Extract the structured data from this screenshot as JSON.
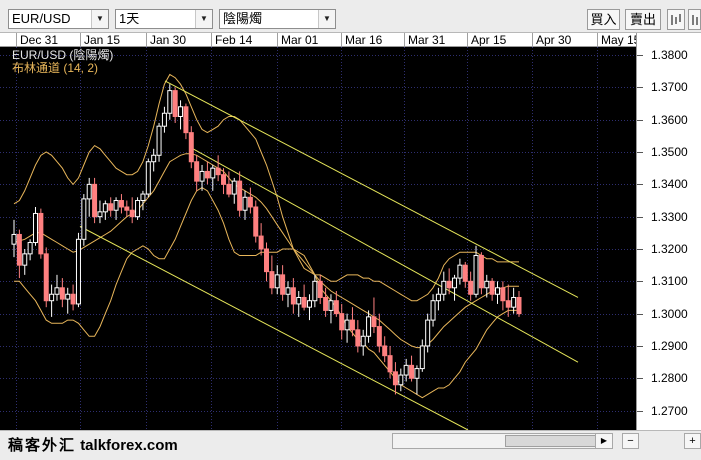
{
  "toolbar": {
    "symbol": "EUR/USD",
    "timeframe": "1天",
    "chart_type": "陰陽燭",
    "buy_label": "買入",
    "sell_label": "賣出",
    "tool_icon": "chart-tools-icon"
  },
  "chart": {
    "legend_symbol": "EUR/USD (陰陽燭)",
    "legend_indicator": "布林通道 (14, 2)",
    "date_labels": [
      "Dec 31",
      "Jan 15",
      "Jan 30",
      "Feb 14",
      "Mar 01",
      "Mar 16",
      "Mar 31",
      "Apr 15",
      "Apr 30",
      "May 15"
    ],
    "price_labels": [
      "1.3800",
      "1.3700",
      "1.3600",
      "1.3500",
      "1.3400",
      "1.3300",
      "1.3200",
      "1.3100",
      "1.3000",
      "1.2900",
      "1.2800",
      "1.2700"
    ],
    "colors": {
      "background": "#000000",
      "grid": "#2e2e70",
      "bollinger": "#e8b65a",
      "trend_lines": "#e6e65a",
      "candle_up": "#ffffff",
      "candle_down": "#ff8080"
    }
  },
  "chart_data": {
    "type": "candlestick",
    "title": "EUR/USD (陰陽燭)",
    "indicator": "布林通道 (14, 2)",
    "ylim": [
      1.264,
      1.3825
    ],
    "grid": true,
    "x_ticks": [
      "Dec 31",
      "Jan 15",
      "Jan 30",
      "Feb 14",
      "Mar 01",
      "Mar 16",
      "Mar 31",
      "Apr 15",
      "Apr 30",
      "May 15"
    ],
    "y_ticks": [
      1.38,
      1.37,
      1.36,
      1.35,
      1.34,
      1.33,
      1.32,
      1.31,
      1.3,
      1.29,
      1.28,
      1.27
    ],
    "candles": [
      [
        1.3215,
        1.329,
        1.3175,
        1.3245
      ],
      [
        1.3245,
        1.326,
        1.311,
        1.315
      ],
      [
        1.315,
        1.32,
        1.312,
        1.3185
      ],
      [
        1.3185,
        1.323,
        1.3165,
        1.322
      ],
      [
        1.322,
        1.333,
        1.321,
        1.331
      ],
      [
        1.331,
        1.3325,
        1.317,
        1.3185
      ],
      [
        1.3185,
        1.3205,
        1.302,
        1.304
      ],
      [
        1.304,
        1.309,
        1.299,
        1.306
      ],
      [
        1.306,
        1.312,
        1.304,
        1.308
      ],
      [
        1.308,
        1.311,
        1.302,
        1.3045
      ],
      [
        1.3045,
        1.308,
        1.3,
        1.306
      ],
      [
        1.306,
        1.309,
        1.301,
        1.303
      ],
      [
        1.303,
        1.325,
        1.302,
        1.323
      ],
      [
        1.323,
        1.337,
        1.321,
        1.3355
      ],
      [
        1.3355,
        1.342,
        1.33,
        1.34
      ],
      [
        1.34,
        1.342,
        1.328,
        1.33
      ],
      [
        1.33,
        1.335,
        1.328,
        1.3315
      ],
      [
        1.3315,
        1.335,
        1.329,
        1.334
      ],
      [
        1.334,
        1.336,
        1.33,
        1.332
      ],
      [
        1.332,
        1.336,
        1.329,
        1.335
      ],
      [
        1.335,
        1.337,
        1.331,
        1.333
      ],
      [
        1.333,
        1.335,
        1.33,
        1.332
      ],
      [
        1.332,
        1.336,
        1.328,
        1.33
      ],
      [
        1.33,
        1.336,
        1.329,
        1.335
      ],
      [
        1.335,
        1.338,
        1.332,
        1.337
      ],
      [
        1.337,
        1.348,
        1.336,
        1.347
      ],
      [
        1.347,
        1.351,
        1.344,
        1.349
      ],
      [
        1.349,
        1.359,
        1.347,
        1.358
      ],
      [
        1.358,
        1.364,
        1.356,
        1.362
      ],
      [
        1.362,
        1.371,
        1.36,
        1.369
      ],
      [
        1.369,
        1.37,
        1.359,
        1.361
      ],
      [
        1.361,
        1.366,
        1.357,
        1.364
      ],
      [
        1.364,
        1.365,
        1.354,
        1.356
      ],
      [
        1.356,
        1.358,
        1.345,
        1.347
      ],
      [
        1.347,
        1.349,
        1.338,
        1.341
      ],
      [
        1.341,
        1.346,
        1.338,
        1.344
      ],
      [
        1.344,
        1.347,
        1.34,
        1.342
      ],
      [
        1.342,
        1.346,
        1.338,
        1.345
      ],
      [
        1.345,
        1.349,
        1.341,
        1.343
      ],
      [
        1.343,
        1.345,
        1.337,
        1.34
      ],
      [
        1.34,
        1.344,
        1.336,
        1.337
      ],
      [
        1.337,
        1.342,
        1.334,
        1.341
      ],
      [
        1.341,
        1.344,
        1.33,
        1.332
      ],
      [
        1.332,
        1.338,
        1.329,
        1.336
      ],
      [
        1.336,
        1.339,
        1.331,
        1.333
      ],
      [
        1.333,
        1.335,
        1.322,
        1.324
      ],
      [
        1.324,
        1.328,
        1.318,
        1.32
      ],
      [
        1.32,
        1.322,
        1.31,
        1.313
      ],
      [
        1.313,
        1.318,
        1.306,
        1.308
      ],
      [
        1.308,
        1.315,
        1.306,
        1.312
      ],
      [
        1.312,
        1.315,
        1.304,
        1.306
      ],
      [
        1.306,
        1.31,
        1.302,
        1.308
      ],
      [
        1.308,
        1.311,
        1.3,
        1.303
      ],
      [
        1.303,
        1.307,
        1.299,
        1.305
      ],
      [
        1.305,
        1.309,
        1.301,
        1.302
      ],
      [
        1.302,
        1.306,
        1.298,
        1.304
      ],
      [
        1.304,
        1.312,
        1.302,
        1.31
      ],
      [
        1.31,
        1.312,
        1.303,
        1.305
      ],
      [
        1.305,
        1.308,
        1.299,
        1.301
      ],
      [
        1.301,
        1.306,
        1.297,
        1.304
      ],
      [
        1.304,
        1.307,
        1.299,
        1.3
      ],
      [
        1.3,
        1.303,
        1.292,
        1.295
      ],
      [
        1.295,
        1.3,
        1.291,
        1.298
      ],
      [
        1.298,
        1.302,
        1.293,
        1.295
      ],
      [
        1.295,
        1.298,
        1.288,
        1.29
      ],
      [
        1.29,
        1.295,
        1.287,
        1.293
      ],
      [
        1.293,
        1.301,
        1.291,
        1.299
      ],
      [
        1.299,
        1.305,
        1.294,
        1.296
      ],
      [
        1.296,
        1.3,
        1.288,
        1.29
      ],
      [
        1.29,
        1.293,
        1.285,
        1.287
      ],
      [
        1.287,
        1.29,
        1.28,
        1.282
      ],
      [
        1.282,
        1.285,
        1.275,
        1.278
      ],
      [
        1.278,
        1.283,
        1.276,
        1.281
      ],
      [
        1.281,
        1.286,
        1.279,
        1.284
      ],
      [
        1.284,
        1.287,
        1.279,
        1.28
      ],
      [
        1.28,
        1.284,
        1.275,
        1.283
      ],
      [
        1.283,
        1.292,
        1.282,
        1.29
      ],
      [
        1.29,
        1.3,
        1.288,
        1.298
      ],
      [
        1.298,
        1.306,
        1.296,
        1.304
      ],
      [
        1.304,
        1.308,
        1.301,
        1.306
      ],
      [
        1.306,
        1.313,
        1.304,
        1.31
      ],
      [
        1.31,
        1.314,
        1.306,
        1.308
      ],
      [
        1.308,
        1.312,
        1.304,
        1.311
      ],
      [
        1.311,
        1.317,
        1.309,
        1.315
      ],
      [
        1.315,
        1.316,
        1.308,
        1.31
      ],
      [
        1.31,
        1.313,
        1.304,
        1.306
      ],
      [
        1.306,
        1.321,
        1.305,
        1.318
      ],
      [
        1.318,
        1.319,
        1.306,
        1.308
      ],
      [
        1.308,
        1.312,
        1.305,
        1.31
      ],
      [
        1.31,
        1.311,
        1.304,
        1.306
      ],
      [
        1.306,
        1.31,
        1.303,
        1.308
      ],
      [
        1.308,
        1.31,
        1.301,
        1.304
      ],
      [
        1.304,
        1.309,
        1.299,
        1.302
      ],
      [
        1.302,
        1.308,
        1.3,
        1.305
      ],
      [
        1.305,
        1.307,
        1.299,
        1.3
      ]
    ],
    "bollinger": {
      "upper": [
        1.334,
        1.335,
        1.338,
        1.342,
        1.346,
        1.349,
        1.35,
        1.349,
        1.347,
        1.345,
        1.342,
        1.34,
        1.342,
        1.346,
        1.35,
        1.352,
        1.351,
        1.349,
        1.347,
        1.345,
        1.344,
        1.343,
        1.343,
        1.344,
        1.347,
        1.352,
        1.358,
        1.365,
        1.371,
        1.374,
        1.373,
        1.371,
        1.368,
        1.364,
        1.36,
        1.357,
        1.356,
        1.357,
        1.358,
        1.36,
        1.361,
        1.361,
        1.36,
        1.358,
        1.356,
        1.354,
        1.35,
        1.346,
        1.341,
        1.336,
        1.33,
        1.325,
        1.32,
        1.317,
        1.314,
        1.313,
        1.312,
        1.312,
        1.311,
        1.31,
        1.31,
        1.311,
        1.312,
        1.312,
        1.312,
        1.311,
        1.311,
        1.31,
        1.31,
        1.309,
        1.308,
        1.307,
        1.306,
        1.305,
        1.304,
        1.304,
        1.305,
        1.306,
        1.308,
        1.311,
        1.315,
        1.317,
        1.318,
        1.319,
        1.319,
        1.319,
        1.319,
        1.318,
        1.317,
        1.317,
        1.316,
        1.316,
        1.316,
        1.316,
        1.316
      ],
      "middle": [
        1.322,
        1.3225,
        1.323,
        1.324,
        1.325,
        1.325,
        1.324,
        1.323,
        1.322,
        1.321,
        1.32,
        1.319,
        1.3195,
        1.3205,
        1.3215,
        1.3225,
        1.3235,
        1.3245,
        1.3255,
        1.327,
        1.3285,
        1.33,
        1.331,
        1.332,
        1.334,
        1.336,
        1.338,
        1.341,
        1.344,
        1.347,
        1.348,
        1.349,
        1.3495,
        1.3495,
        1.349,
        1.348,
        1.347,
        1.346,
        1.345,
        1.344,
        1.342,
        1.34,
        1.339,
        1.338,
        1.337,
        1.336,
        1.3345,
        1.3325,
        1.33,
        1.3275,
        1.325,
        1.3225,
        1.32,
        1.318,
        1.316,
        1.314,
        1.312,
        1.31,
        1.3085,
        1.307,
        1.306,
        1.305,
        1.304,
        1.303,
        1.302,
        1.301,
        1.3,
        1.299,
        1.298,
        1.2965,
        1.295,
        1.2935,
        1.292,
        1.291,
        1.29,
        1.2895,
        1.2895,
        1.2905,
        1.292,
        1.294,
        1.296,
        1.2975,
        1.299,
        1.3005,
        1.302,
        1.303,
        1.304,
        1.305,
        1.306,
        1.307,
        1.3075,
        1.308,
        1.3085,
        1.3085,
        1.3085
      ],
      "lower": [
        1.31,
        1.31,
        1.308,
        1.306,
        1.304,
        1.301,
        1.298,
        1.297,
        1.297,
        1.297,
        1.298,
        1.298,
        1.297,
        1.295,
        1.293,
        1.293,
        1.296,
        1.3,
        1.304,
        1.309,
        1.313,
        1.317,
        1.319,
        1.32,
        1.321,
        1.32,
        1.318,
        1.317,
        1.317,
        1.32,
        1.323,
        1.327,
        1.331,
        1.335,
        1.338,
        1.339,
        1.338,
        1.335,
        1.332,
        1.328,
        1.323,
        1.319,
        1.318,
        1.318,
        1.318,
        1.318,
        1.319,
        1.319,
        1.319,
        1.319,
        1.32,
        1.32,
        1.32,
        1.319,
        1.318,
        1.315,
        1.312,
        1.308,
        1.306,
        1.304,
        1.302,
        1.299,
        1.296,
        1.294,
        1.292,
        1.291,
        1.289,
        1.288,
        1.286,
        1.284,
        1.282,
        1.28,
        1.278,
        1.277,
        1.276,
        1.275,
        1.274,
        1.275,
        1.276,
        1.277,
        1.277,
        1.278,
        1.28,
        1.282,
        1.285,
        1.287,
        1.289,
        1.292,
        1.295,
        1.297,
        1.299,
        1.3,
        1.301,
        1.301,
        1.301
      ]
    },
    "trend_lines": [
      {
        "from": [
          "Jan 30",
          1.372
        ],
        "to": [
          "May 15",
          1.305
        ]
      },
      {
        "from": [
          "Feb 05",
          1.351
        ],
        "to": [
          "May 15",
          1.285
        ]
      },
      {
        "from": [
          "Jan 15",
          1.327
        ],
        "to": [
          "Apr 17",
          1.264
        ]
      }
    ]
  },
  "footer": {
    "watermark_cn": "稿客外汇",
    "watermark_url": "talkforex.com"
  }
}
